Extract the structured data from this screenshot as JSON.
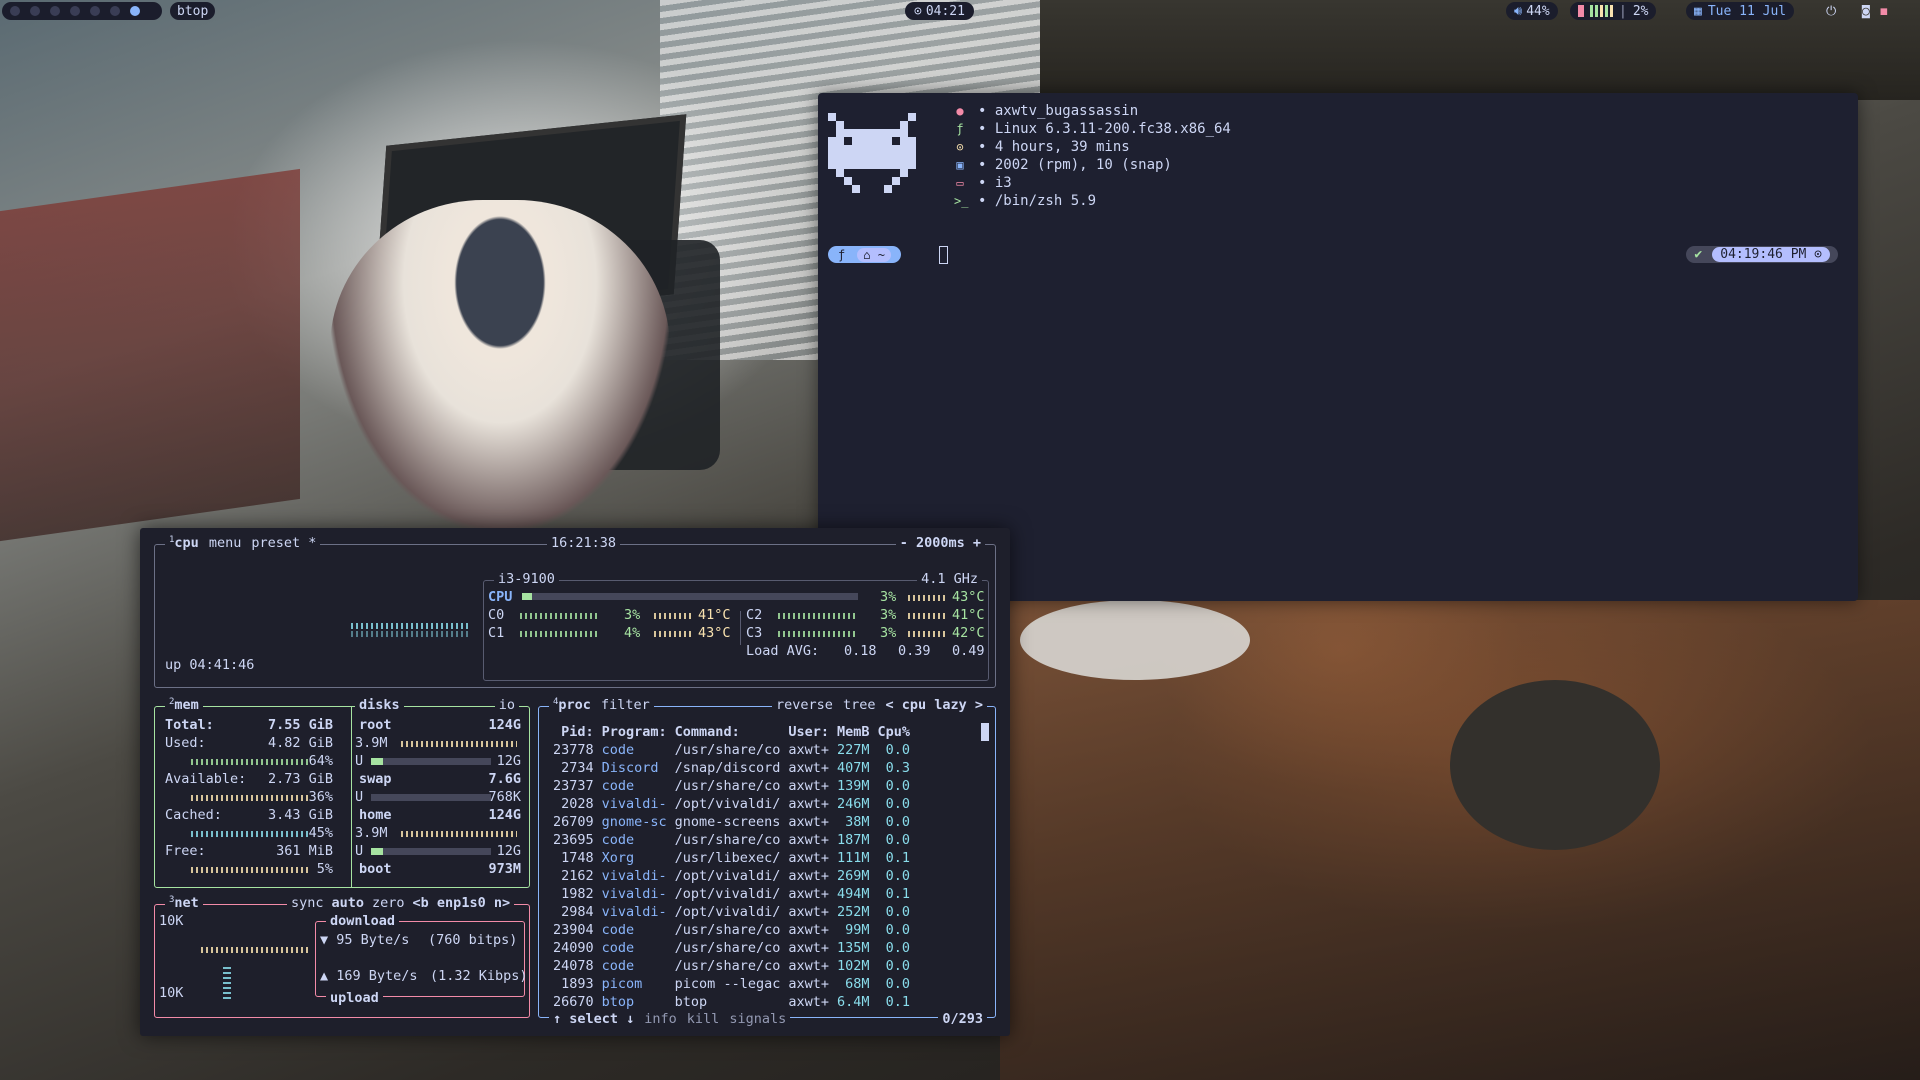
{
  "topbar": {
    "app_name": "btop",
    "clock": "04:21",
    "volume": "44%",
    "cpu_usage": "2%",
    "date": "Tue 11 Jul"
  },
  "terminal": {
    "fetch": [
      {
        "icon": "user-icon",
        "color": "#f38ba8",
        "text": "• axwtv_bugassassin"
      },
      {
        "icon": "linux-icon",
        "color": "#a6e3a1",
        "text": "• Linux 6.3.11-200.fc38.x86_64"
      },
      {
        "icon": "uptime-icon",
        "color": "#f9e2af",
        "text": "• 4 hours, 39 mins"
      },
      {
        "icon": "package-icon",
        "color": "#89b4fa",
        "text": "• 2002 (rpm), 10 (snap)"
      },
      {
        "icon": "window-manager-icon",
        "color": "#f38ba8",
        "text": "• i3"
      },
      {
        "icon": "shell-icon",
        "color": "#a6e3a1",
        "text": "• /bin/zsh 5.9"
      }
    ],
    "prompt_dir": "~",
    "prompt_time": "04:19:46 PM"
  },
  "btop": {
    "cpu_box": {
      "title": "cpu",
      "num": "1",
      "menu": "menu",
      "preset": "preset *",
      "time": "16:21:38",
      "interval": "- 2000ms +",
      "model": "i3-9100",
      "freq": "4.1 GHz",
      "uptime": "up 04:41:46",
      "total": {
        "label": "CPU",
        "pct": "3%",
        "temp": "43°C",
        "fill": 0.03
      },
      "cores": [
        {
          "label": "C0",
          "pct": "3%",
          "temp": "41°C"
        },
        {
          "label": "C1",
          "pct": "4%",
          "temp": "43°C"
        },
        {
          "label": "C2",
          "pct": "3%",
          "temp": "41°C"
        },
        {
          "label": "C3",
          "pct": "3%",
          "temp": "42°C"
        }
      ],
      "load_label": "Load AVG:",
      "load": [
        "0.18",
        "0.39",
        "0.49"
      ]
    },
    "mem_box": {
      "title": "mem",
      "num": "2",
      "disks_title": "disks",
      "io": "io",
      "rows": [
        {
          "label": "Total:",
          "value": "7.55 GiB",
          "pct": ""
        },
        {
          "label": "Used:",
          "value": "4.82 GiB",
          "pct": "64%"
        },
        {
          "label": "Available:",
          "value": "2.73 GiB",
          "pct": "36%"
        },
        {
          "label": "Cached:",
          "value": "3.43 GiB",
          "pct": "45%"
        },
        {
          "label": "Free:",
          "value": "361 MiB",
          "pct": "5%"
        }
      ],
      "disks": [
        {
          "name": "root",
          "size": "124G",
          "io": "3.9M",
          "u": "U",
          "used": "12G",
          "fill": 0.1
        },
        {
          "name": "swap",
          "size": "7.6G",
          "io": "",
          "u": "U",
          "used": "768K",
          "fill": 0.0
        },
        {
          "name": "home",
          "size": "124G",
          "io": "3.9M",
          "u": "U",
          "used": "12G",
          "fill": 0.1
        },
        {
          "name": "boot",
          "size": "973M",
          "io": "",
          "u": "",
          "used": "",
          "fill": 0
        }
      ]
    },
    "net_box": {
      "title": "net",
      "num": "3",
      "sync": "sync",
      "auto": "auto",
      "zero": "zero",
      "iface": "<b enp1s0 n>",
      "scale_top": "10K",
      "scale_bottom": "10K",
      "download_label": "download",
      "download": "95 Byte/s",
      "download_bits": "(760 bitps)",
      "upload": "169 Byte/s",
      "upload_bits": "(1.32 Kibps)",
      "upload_label": "upload"
    },
    "proc_box": {
      "title": "proc",
      "num": "4",
      "filter": "filter",
      "reverse": "reverse",
      "tree": "tree",
      "sort": "< cpu lazy >",
      "headers": [
        "Pid:",
        "Program:",
        "Command:",
        "User:",
        "MemB",
        "Cpu%"
      ],
      "rows": [
        [
          "23778",
          "code",
          "/usr/share/co",
          "axwt+",
          "227M",
          "0.0"
        ],
        [
          "2734",
          "Discord",
          "/snap/discord",
          "axwt+",
          "407M",
          "0.3"
        ],
        [
          "23737",
          "code",
          "/usr/share/co",
          "axwt+",
          "139M",
          "0.0"
        ],
        [
          "2028",
          "vivaldi-",
          "/opt/vivaldi/",
          "axwt+",
          "246M",
          "0.0"
        ],
        [
          "26709",
          "gnome-sc",
          "gnome-screens",
          "axwt+",
          "38M",
          "0.0"
        ],
        [
          "23695",
          "code",
          "/usr/share/co",
          "axwt+",
          "187M",
          "0.0"
        ],
        [
          "1748",
          "Xorg",
          "/usr/libexec/",
          "axwt+",
          "111M",
          "0.1"
        ],
        [
          "2162",
          "vivaldi-",
          "/opt/vivaldi/",
          "axwt+",
          "269M",
          "0.0"
        ],
        [
          "1982",
          "vivaldi-",
          "/opt/vivaldi/",
          "axwt+",
          "494M",
          "0.1"
        ],
        [
          "2984",
          "vivaldi-",
          "/opt/vivaldi/",
          "axwt+",
          "252M",
          "0.0"
        ],
        [
          "23904",
          "code",
          "/usr/share/co",
          "axwt+",
          "99M",
          "0.0"
        ],
        [
          "24090",
          "code",
          "/usr/share/co",
          "axwt+",
          "135M",
          "0.0"
        ],
        [
          "24078",
          "code",
          "/usr/share/co",
          "axwt+",
          "102M",
          "0.0"
        ],
        [
          "1893",
          "picom",
          "picom --legac",
          "axwt+",
          "68M",
          "0.0"
        ],
        [
          "26670",
          "btop",
          "btop",
          "axwt+",
          "6.4M",
          "0.1"
        ]
      ],
      "footer_select": "↑ select ↓",
      "footer_info": "info",
      "footer_kill": "kill",
      "footer_signals": "signals",
      "count": "0/293"
    }
  },
  "colors": {
    "accent": "#89b4fa",
    "green": "#a6e3a1",
    "yellow": "#f9e2af",
    "red": "#f38ba8",
    "bg": "#1e1f2b"
  }
}
